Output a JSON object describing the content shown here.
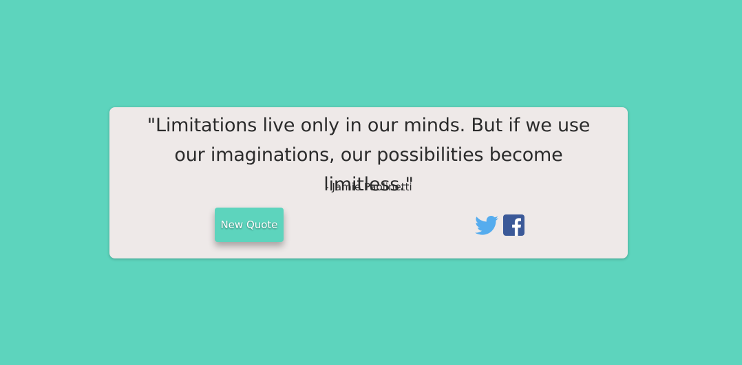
{
  "quote": {
    "text": "\"Limitations live only in our minds. But if we use our imaginations, our possibilities become limitless.\"",
    "author": "- Jamie Paolinetti"
  },
  "actions": {
    "new_quote_label": "New Quote"
  },
  "share": {
    "twitter_icon": "twitter-icon",
    "facebook_icon": "facebook-icon"
  },
  "colors": {
    "background": "#5dd4bd",
    "card": "#eee9e8",
    "twitter": "#55acee",
    "facebook": "#3b5998"
  }
}
